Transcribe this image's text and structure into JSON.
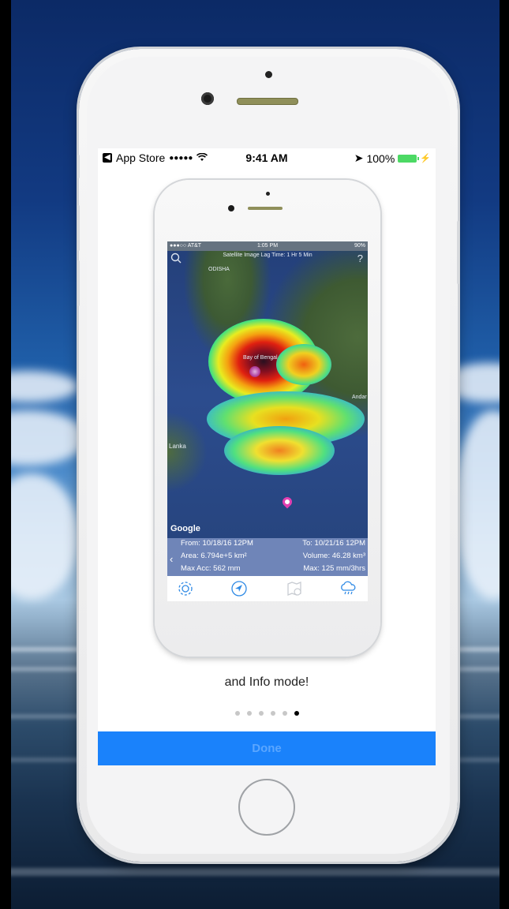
{
  "outer_status": {
    "back_app": "App Store",
    "signal": "●●●●●",
    "time": "9:41 AM",
    "battery": "100%"
  },
  "inner_status": {
    "carrier": "●●●○○ AT&T",
    "time": "1:05 PM",
    "battery": "90%"
  },
  "map": {
    "lag_text": "Satellite Image Lag Time: 1 Hr 5 Min",
    "help_glyph": "?",
    "labels": {
      "odisha": "ODISHA",
      "bay": "Bay of Bengal",
      "andaman": "Andar",
      "lanka": "Lanka"
    },
    "attribution": "Google"
  },
  "info": {
    "from": "From: 10/18/16 12PM",
    "to": "To: 10/21/16 12PM",
    "area": "Area: 6.794e+5 km²",
    "volume": "Volume: 46.28 km³",
    "max_acc": "Max Acc: 562 mm",
    "max_rate": "Max: 125 mm/3hrs"
  },
  "tabbar": {
    "icons": [
      "gear-icon",
      "location-arrow-icon",
      "map-icon",
      "rain-cloud-icon"
    ]
  },
  "caption": "and Info mode!",
  "pager": {
    "total": 6,
    "current": 6
  },
  "done_label": "Done",
  "colors": {
    "done_bg": "#1a82fb",
    "info_bg": "#6f85b8",
    "battery": "#4cd964"
  }
}
